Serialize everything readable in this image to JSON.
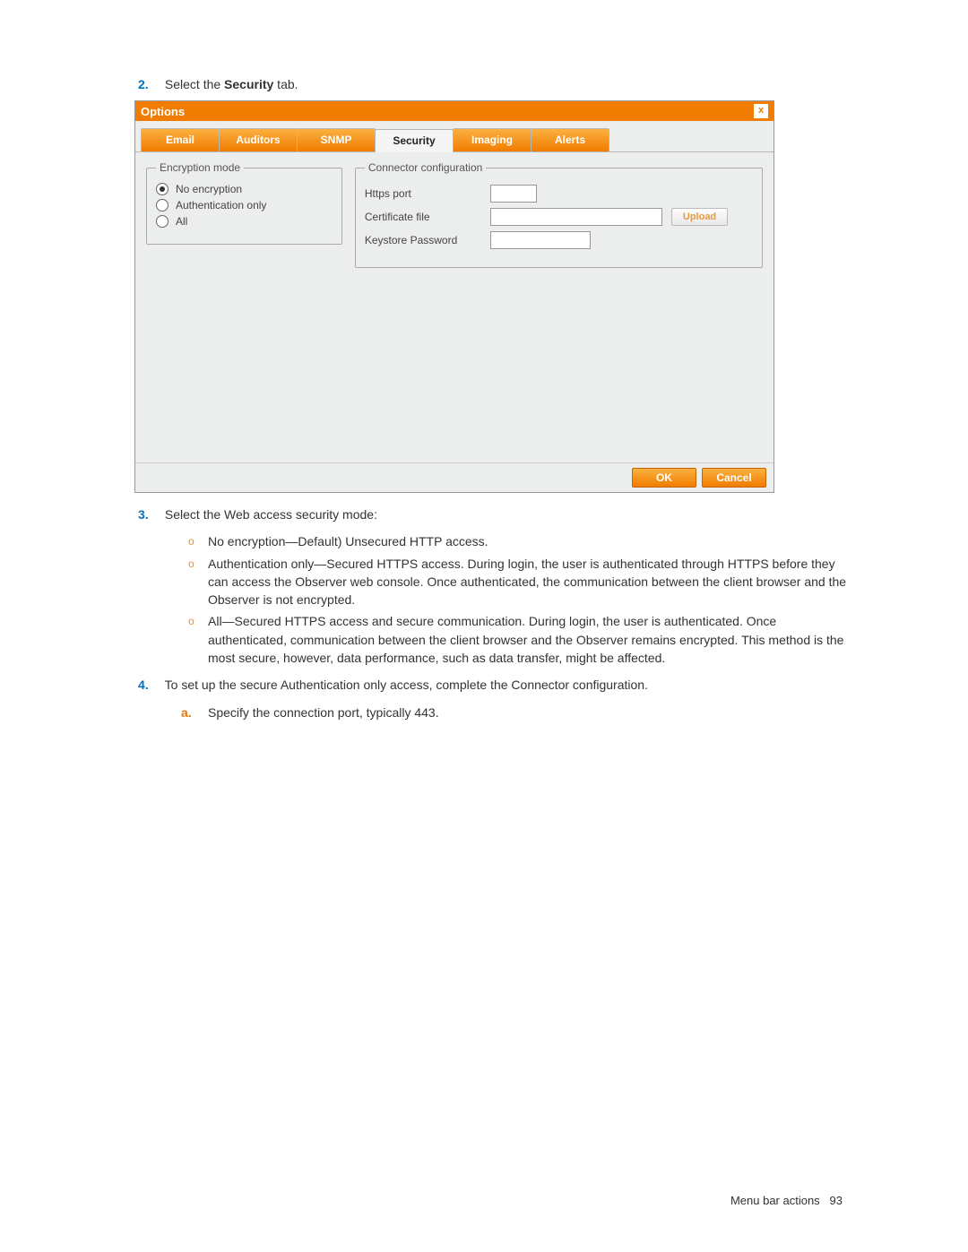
{
  "step2": {
    "num": "2.",
    "prefix": "Select the ",
    "bold": "Security",
    "suffix": " tab."
  },
  "dialog": {
    "title": "Options",
    "close": "x",
    "tabs": [
      "Email",
      "Auditors",
      "SNMP",
      "Security",
      "Imaging",
      "Alerts"
    ],
    "activeTab": "Security",
    "encryption": {
      "legend": "Encryption mode",
      "options": [
        "No encryption",
        "Authentication only",
        "All"
      ],
      "selected": "No encryption"
    },
    "connector": {
      "legend": "Connector configuration",
      "httpsPort": "Https port",
      "certFile": "Certificate file",
      "upload": "Upload",
      "keystore": "Keystore Password"
    },
    "ok": "OK",
    "cancel": "Cancel"
  },
  "step3": {
    "num": "3.",
    "text": "Select the Web access security mode:",
    "bullets": [
      "No encryption—Default) Unsecured HTTP access.",
      "Authentication only—Secured HTTPS access. During login, the user is authenticated through HTTPS before they can access the Observer web console. Once authenticated, the communication between the client browser and the Observer is not encrypted.",
      "All—Secured HTTPS access and secure communication. During login, the user is authenticated. Once authenticated, communication between the client browser and the Observer remains encrypted. This method is the most secure, however, data performance, such as data transfer, might be affected."
    ]
  },
  "step4": {
    "num": "4.",
    "text": "To set up the secure Authentication only access, complete the Connector configuration.",
    "sub": {
      "letter": "a.",
      "text": "Specify the connection port, typically 443."
    }
  },
  "footer": {
    "section": "Menu bar actions",
    "page": "93"
  }
}
